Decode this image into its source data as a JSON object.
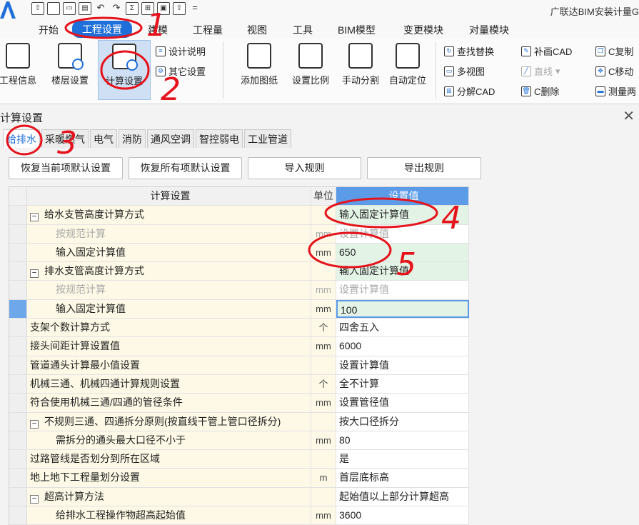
{
  "app": {
    "title": "广联达BIM安装计量G"
  },
  "quick_access": [
    "save-icon",
    "new-icon",
    "open-icon",
    "print-icon",
    "undo-icon",
    "redo-icon",
    "sum-icon",
    "grid-icon",
    "view-icon",
    "export-icon"
  ],
  "menu": {
    "items": [
      "开始",
      "工程设置",
      "建模",
      "工程量",
      "视图",
      "工具",
      "BIM模型",
      "变更模块",
      "对量模块"
    ],
    "active": "工程设置"
  },
  "ribbon": {
    "project_info": "工程信息",
    "floor_settings": "楼层设置",
    "calc_settings": "计算设置",
    "design_notes": "设计说明",
    "other_settings": "其它设置",
    "add_drawing": "添加图纸",
    "set_scale": "设置比例",
    "manual_split": "手动分割",
    "auto_locate": "自动定位",
    "find_replace": "查找替换",
    "redraw_cad": "补画CAD",
    "copy_c": "C复制",
    "multi_view": "多视图",
    "line": "直线",
    "move_c": "C移动",
    "explode_cad": "分解CAD",
    "delete_c": "C删除",
    "measure": "测量两"
  },
  "dialog": {
    "title": "计算设置",
    "tabs": [
      "给排水",
      "采暖燃气",
      "电气",
      "消防",
      "通风空调",
      "智控弱电",
      "工业管道"
    ],
    "active_tab": "给排水",
    "buttons": {
      "restore_current": "恢复当前项默认设置",
      "restore_all": "恢复所有项默认设置",
      "import": "导入规则",
      "export": "导出规则"
    },
    "table": {
      "headers": {
        "name": "计算设置",
        "unit": "单位",
        "value": "设置值"
      },
      "rows": [
        {
          "name": "给水支管高度计算方式",
          "unit": "",
          "value": "输入固定计算值",
          "toggle": "−"
        },
        {
          "name": "按规范计算",
          "unit": "mm",
          "value": "设置计算值"
        },
        {
          "name": "输入固定计算值",
          "unit": "mm",
          "value": "650"
        },
        {
          "name": "排水支管高度计算方式",
          "unit": "",
          "value": "输入固定计算值",
          "toggle": "−"
        },
        {
          "name": "按规范计算",
          "unit": "mm",
          "value": "设置计算值"
        },
        {
          "name": "输入固定计算值",
          "unit": "mm",
          "value": "100"
        },
        {
          "name": "支架个数计算方式",
          "unit": "个",
          "value": "四舍五入"
        },
        {
          "name": "接头间距计算设置值",
          "unit": "mm",
          "value": "6000"
        },
        {
          "name": "管道通头计算最小值设置",
          "unit": "",
          "value": "设置计算值"
        },
        {
          "name": "机械三通、机械四通计算规则设置",
          "unit": "个",
          "value": "全不计算"
        },
        {
          "name": "符合使用机械三通/四通的管径条件",
          "unit": "mm",
          "value": "设置管径值"
        },
        {
          "name": "不规则三通、四通拆分原则(按直线干管上管口径拆分)",
          "unit": "",
          "value": "按大口径拆分",
          "toggle": "−"
        },
        {
          "name": "需拆分的通头最大口径不小于",
          "unit": "mm",
          "value": "80"
        },
        {
          "name": "过路管线是否划分到所在区域",
          "unit": "",
          "value": "是"
        },
        {
          "name": "地上地下工程量划分设置",
          "unit": "m",
          "value": "首层底标高"
        },
        {
          "name": "超高计算方法",
          "unit": "",
          "value": "起始值以上部分计算超高",
          "toggle": "−"
        },
        {
          "name": "给排水工程操作物超高起始值",
          "unit": "mm",
          "value": "3600"
        }
      ]
    }
  },
  "annotations": [
    "1",
    "2",
    "3",
    "4",
    "5"
  ],
  "colors": {
    "accent": "#1e6fd9",
    "annotation": "#e5131c",
    "header_value": "#5b9be8",
    "name_cell": "#fdf9e6"
  }
}
